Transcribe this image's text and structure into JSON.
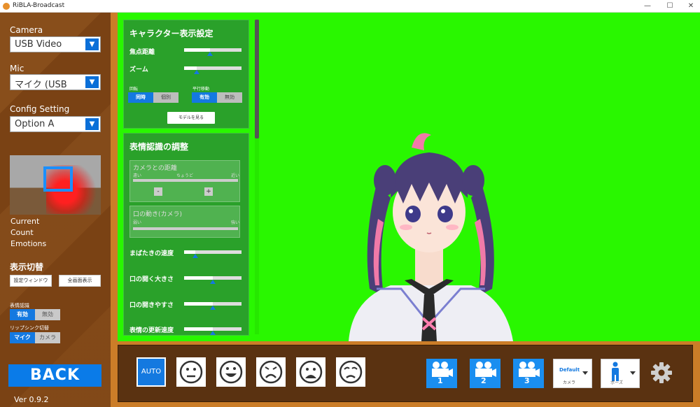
{
  "window": {
    "title": "RiBLA-Broadcast",
    "minimize_glyph": "—",
    "maximize_glyph": "☐",
    "close_glyph": "✕"
  },
  "sidebar": {
    "camera_label": "Camera",
    "camera_value": "USB Video",
    "mic_label": "Mic",
    "mic_value": "マイク (USB",
    "config_label": "Config Setting",
    "config_value": "Option A",
    "stats": [
      "Current",
      "Count",
      "Emotions"
    ],
    "display_switch_title": "表示切替",
    "settings_window_btn": "設定ウィンドウ",
    "fullscreen_btn": "全画面表示",
    "face_recognition_label": "表情認識",
    "face_recognition_on": "有効",
    "face_recognition_off": "無効",
    "lipsync_label": "リップシンク切替",
    "lipsync_mic": "マイク",
    "lipsync_camera": "カメラ",
    "back_label": "BACK",
    "version": "Ver 0.9.2",
    "dropdown_arrow": "▼"
  },
  "character_panel": {
    "title": "キャラクター表示設定",
    "focal_label": "焦点距離",
    "focal_value": 0.45,
    "zoom_label": "ズーム",
    "zoom_value": 0.22,
    "rotation_label": "回転",
    "rotation_on": "同時",
    "rotation_off": "個別",
    "translation_label": "平行移動",
    "translation_on": "有効",
    "translation_off": "無効",
    "view_model_btn": "モデルを見る"
  },
  "expression_panel": {
    "title": "表情認識の調整",
    "camera_distance_label": "カメラとの距離",
    "near_label": "遠い",
    "mid_label": "ちょうど",
    "far_label": "近い",
    "minus": "-",
    "plus": "+",
    "mouth_cam_label": "口の動き(カメラ)",
    "weak_label": "弱い",
    "strong_label": "強い",
    "blink_label": "まばたきの速度",
    "blink_value": 0.2,
    "mouth_open_label": "口の開く大きさ",
    "mouth_open_value": 0.5,
    "mouth_ease_label": "口の開きやすさ",
    "mouth_ease_value": 0.5,
    "update_speed_label": "表情の更新速度",
    "update_speed_value": 0.5
  },
  "toolbar": {
    "auto_label": "AUTO",
    "emotions": [
      "neutral-face-icon",
      "happy-face-icon",
      "sad-face-icon",
      "frown-face-icon",
      "worried-face-icon"
    ],
    "cameras": [
      "1",
      "2",
      "3"
    ],
    "camera_select_value": "Default",
    "camera_select_caption": "カメラ",
    "pose_select_caption": "ポーズ"
  },
  "colors": {
    "accent": "#1479e0",
    "sidebar": "#7a4214",
    "frame": "#cb7d28",
    "greenscreen": "#29f700",
    "panel": "#2aa12a"
  }
}
